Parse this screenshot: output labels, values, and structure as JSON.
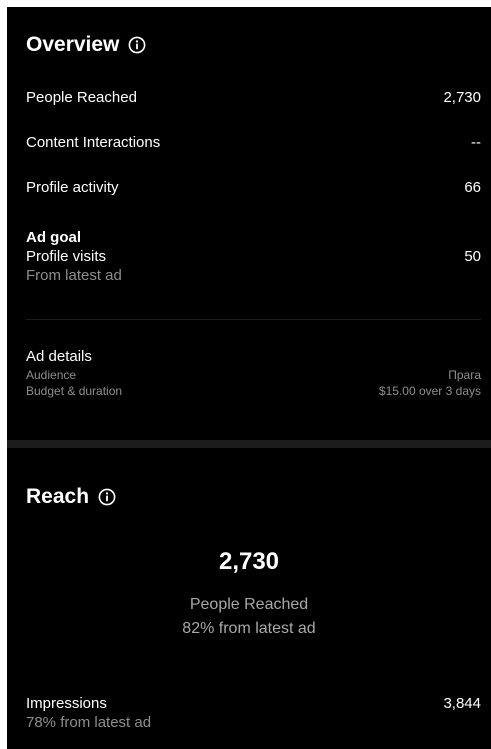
{
  "overview": {
    "title": "Overview",
    "rows": [
      {
        "label": "People Reached",
        "value": "2,730"
      },
      {
        "label": "Content Interactions",
        "value": "--"
      },
      {
        "label": "Profile activity",
        "value": "66"
      }
    ],
    "ad_goal": {
      "heading": "Ad goal",
      "label": "Profile visits",
      "value": "50",
      "note": "From latest ad"
    },
    "ad_details": {
      "heading": "Ad details",
      "audience_label": "Audience",
      "audience_value": "Прага",
      "budget_label": "Budget & duration",
      "budget_value": "$15.00 over 3 days"
    }
  },
  "reach": {
    "title": "Reach",
    "number": "2,730",
    "label": "People Reached",
    "note": "82% from latest ad",
    "impressions": {
      "label": "Impressions",
      "value": "3,844",
      "note": "78% from latest ad"
    }
  },
  "icons": {
    "info": "info-circle-icon"
  }
}
